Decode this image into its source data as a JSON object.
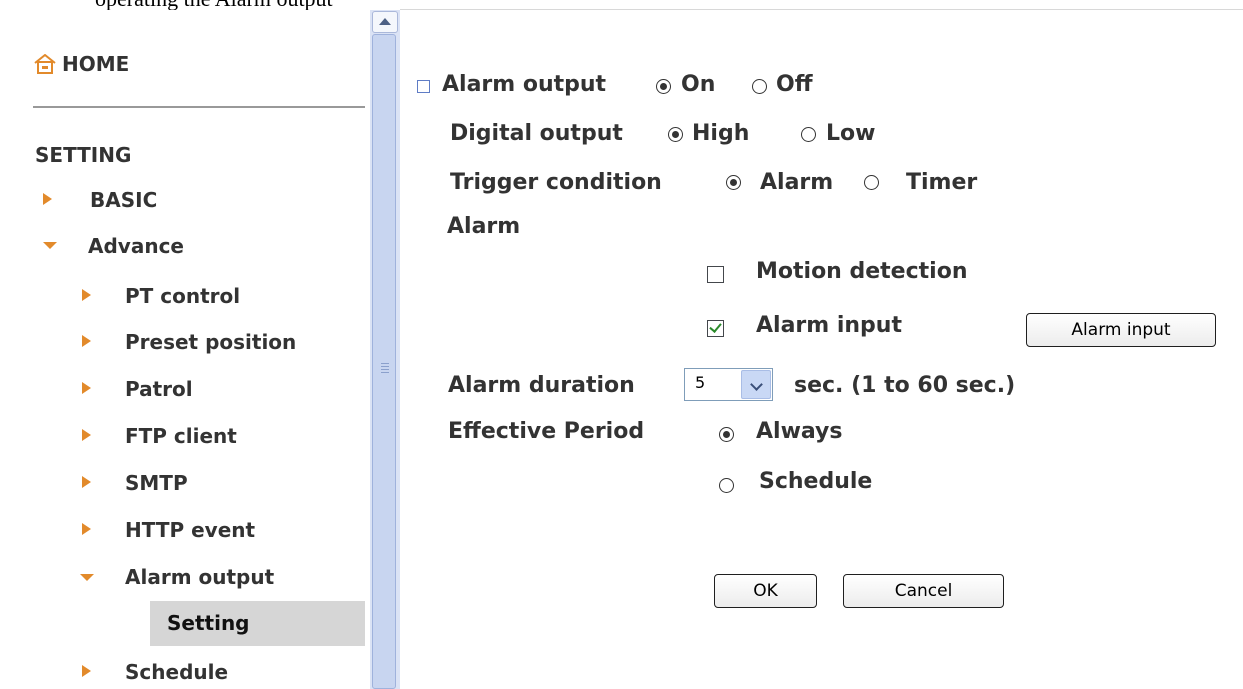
{
  "sidebar": {
    "home_label": "HOME",
    "section_label": "SETTING",
    "items": [
      {
        "label": "BASIC"
      },
      {
        "label": "Advance"
      },
      {
        "label": "PT control"
      },
      {
        "label": "Preset position"
      },
      {
        "label": "Patrol"
      },
      {
        "label": "FTP client"
      },
      {
        "label": "SMTP"
      },
      {
        "label": "HTTP event"
      },
      {
        "label": "Alarm output"
      },
      {
        "label": "Setting"
      },
      {
        "label": "Schedule"
      }
    ]
  },
  "form": {
    "alarm_output": {
      "label": "Alarm output",
      "options": [
        "On",
        "Off"
      ],
      "selected": "On"
    },
    "digital_output": {
      "label": "Digital output",
      "options": [
        "High",
        "Low"
      ],
      "selected": "High"
    },
    "trigger_condition": {
      "label": "Trigger condition",
      "options": [
        "Alarm",
        "Timer"
      ],
      "selected": "Alarm"
    },
    "alarm_heading": "Alarm",
    "motion_detection": {
      "label": "Motion detection",
      "checked": false
    },
    "alarm_input": {
      "label": "Alarm input",
      "checked": true,
      "button_label": "Alarm input"
    },
    "alarm_duration": {
      "label": "Alarm duration",
      "value": "5",
      "suffix": "sec. (1 to 60 sec.)"
    },
    "effective_period": {
      "label": "Effective Period",
      "options": [
        "Always",
        "Schedule"
      ],
      "selected": "Always"
    },
    "ok_label": "OK",
    "cancel_label": "Cancel"
  },
  "colors": {
    "arrow": "#e28a2b",
    "text": "#333333",
    "scrollbar": "#dbe3f5",
    "selected_bg": "#d6d6d6"
  }
}
